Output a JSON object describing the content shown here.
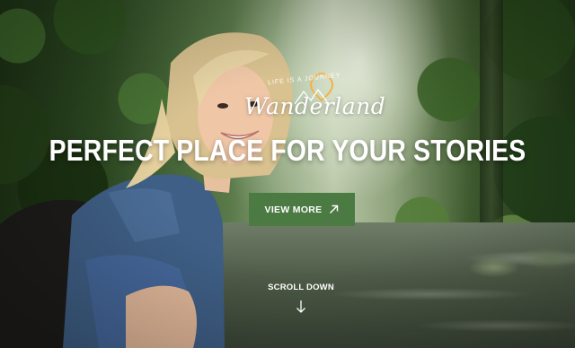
{
  "brand": {
    "tagline": "LIFE IS A JOURNEY",
    "name": "Wanderland"
  },
  "hero": {
    "headline": "PERFECT PLACE FOR YOUR STORIES",
    "cta_label": "VIEW MORE",
    "cta_icon": "arrow-up-right-icon",
    "scroll_label": "SCROLL DOWN",
    "scroll_icon": "arrow-down-icon"
  },
  "colors": {
    "accent": "#4b7a43",
    "logo_accent": "#f3b24a",
    "text": "#ffffff"
  }
}
